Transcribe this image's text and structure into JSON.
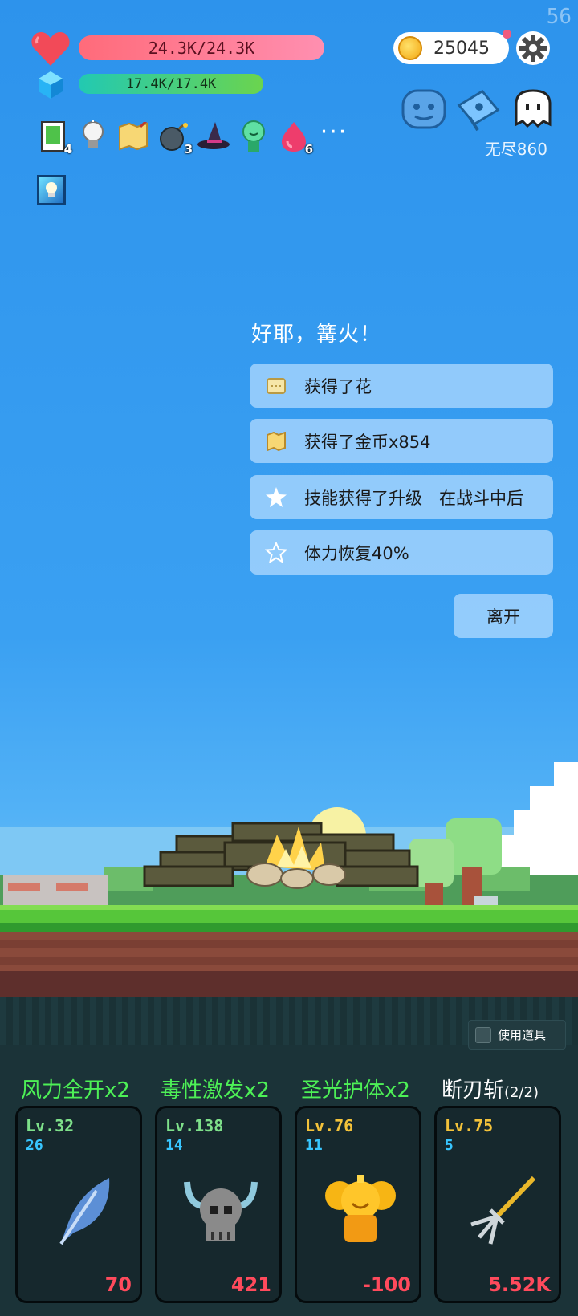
{
  "fps": "56",
  "hud": {
    "hp_text": "24.3K/24.3K",
    "mp_text": "17.4K/17.4K",
    "coins": "25045",
    "endless": "无尽860"
  },
  "items": [
    {
      "icon": "green-card-icon",
      "count": "4"
    },
    {
      "icon": "lightbulb-icon",
      "count": ""
    },
    {
      "icon": "map-scroll-icon",
      "count": ""
    },
    {
      "icon": "bomb-icon",
      "count": "3"
    },
    {
      "icon": "witch-hat-icon",
      "count": ""
    },
    {
      "icon": "green-potion-icon",
      "count": ""
    },
    {
      "icon": "flame-drop-icon",
      "count": "6"
    }
  ],
  "more": "···",
  "event": {
    "title": "好耶，篝火！",
    "options": [
      {
        "icon": "flower-scroll-icon",
        "text": "获得了花"
      },
      {
        "icon": "map-scroll-icon",
        "text": "获得了金币x854"
      },
      {
        "icon": "star-filled-icon",
        "text": "技能获得了升级　在战斗中后"
      },
      {
        "icon": "star-outline-icon",
        "text": "体力恢复40%"
      }
    ],
    "leave": "离开"
  },
  "bottom": {
    "use_item": "使用道具"
  },
  "skills": [
    {
      "name": "风力全开x2",
      "lv": "Lv.32",
      "count": "26",
      "value": "70",
      "color": "green"
    },
    {
      "name": "毒性激发x2",
      "lv": "Lv.138",
      "count": "14",
      "value": "421",
      "color": "green"
    },
    {
      "name": "圣光护体x2",
      "lv": "Lv.76",
      "count": "11",
      "value": "-100",
      "color": "green"
    },
    {
      "name": "断刃斩",
      "name_suffix": "(2/2)",
      "lv": "Lv.75",
      "count": "5",
      "value": "5.52K",
      "color": "white"
    }
  ]
}
